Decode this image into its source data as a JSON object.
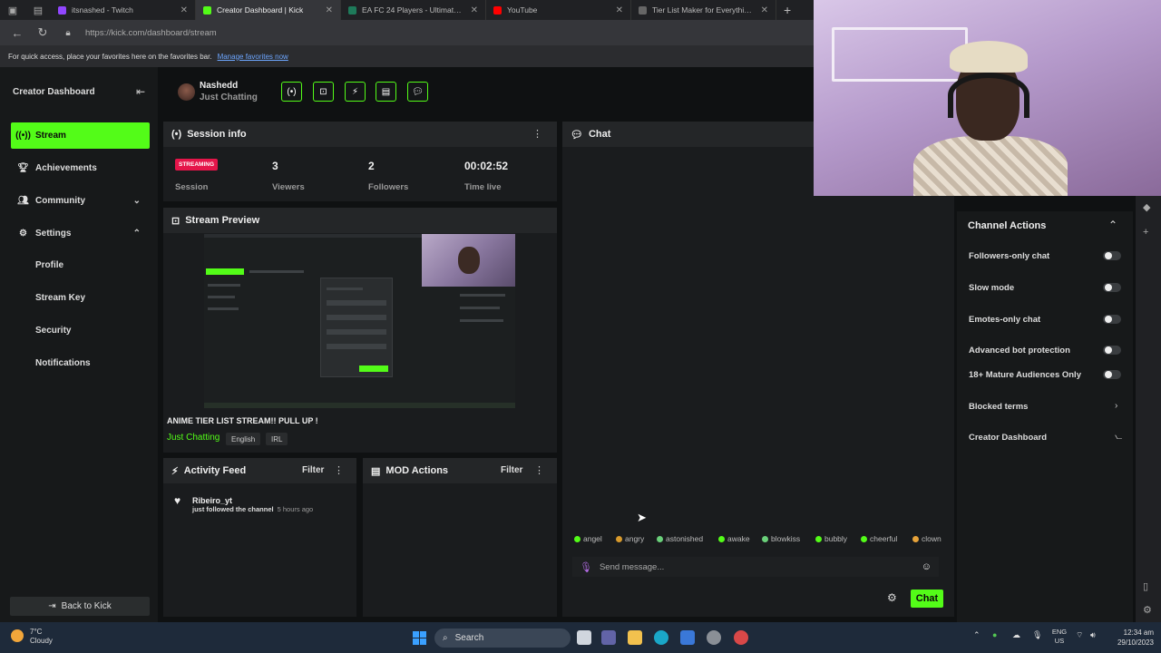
{
  "browser": {
    "tabs": [
      {
        "title": "itsnashed - Twitch",
        "color": "#9146ff"
      },
      {
        "title": "Creator Dashboard | Kick",
        "color": "#53fc18"
      },
      {
        "title": "EA FC 24 Players - Ultimate Team",
        "color": "#1e7a5a"
      },
      {
        "title": "YouTube",
        "color": "#ff0000"
      },
      {
        "title": "Tier List Maker for Everything - T",
        "color": "#444"
      }
    ],
    "url": "https://kick.com/dashboard/stream",
    "favorites_text": "For quick access, place your favorites here on the favorites bar.",
    "favorites_link": "Manage favorites now"
  },
  "sidebar": {
    "title": "Creator Dashboard",
    "items": [
      {
        "label": "Stream",
        "icon": "broadcast-icon"
      },
      {
        "label": "Achievements",
        "icon": "trophy-icon"
      },
      {
        "label": "Community",
        "icon": "people-icon"
      },
      {
        "label": "Settings",
        "icon": "gear-icon"
      }
    ],
    "settings_sub": [
      "Profile",
      "Stream Key",
      "Security",
      "Notifications"
    ],
    "back": "Back to Kick"
  },
  "header": {
    "name": "Nashedd",
    "category": "Just Chatting"
  },
  "session": {
    "title": "Session info",
    "badge": "STREAMING",
    "stats": [
      {
        "label": "Session",
        "value": ""
      },
      {
        "label": "Viewers",
        "value": "3"
      },
      {
        "label": "Followers",
        "value": "2"
      },
      {
        "label": "Time live",
        "value": "00:02:52"
      }
    ]
  },
  "preview": {
    "title": "Stream Preview",
    "stream_title": "ANIME TIER LIST STREAM!! PULL UP !",
    "category": "Just Chatting",
    "tags": [
      "English",
      "IRL"
    ]
  },
  "activity": {
    "title": "Activity Feed",
    "filter": "Filter",
    "items": [
      {
        "user": "Ribeiro_yt",
        "text": "just followed the channel",
        "time": "5 hours ago"
      }
    ]
  },
  "mod": {
    "title": "MOD Actions",
    "filter": "Filter"
  },
  "chat": {
    "title": "Chat",
    "emotes": [
      "angel",
      "angry",
      "astonished",
      "awake",
      "blowkiss",
      "bubbly",
      "cheerful",
      "clown"
    ],
    "placeholder": "Send message...",
    "send": "Chat"
  },
  "channel_actions": {
    "title": "Channel Actions",
    "toggles": [
      "Followers-only chat",
      "Slow mode",
      "Emotes-only chat",
      "Advanced bot protection",
      "18+ Mature Audiences Only"
    ],
    "links": [
      "Blocked terms",
      "Creator Dashboard"
    ]
  },
  "taskbar": {
    "temp": "7°C",
    "weather": "Cloudy",
    "search": "Search",
    "lang1": "ENG",
    "lang2": "US",
    "time": "12:34 am",
    "date": "29/10/2023"
  }
}
